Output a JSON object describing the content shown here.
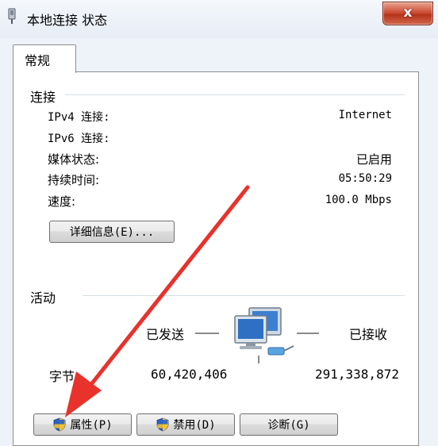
{
  "window": {
    "title": "本地连接 状态",
    "close_label": "x"
  },
  "tabs": [
    {
      "label": "常规"
    }
  ],
  "connection": {
    "section_label": "连接",
    "rows": [
      {
        "label": "IPv4 连接:",
        "value": "Internet"
      },
      {
        "label": "IPv6 连接:",
        "value": ""
      },
      {
        "label": "媒体状态:",
        "value": "已启用"
      },
      {
        "label": "持续时间:",
        "value": "05:50:29"
      },
      {
        "label": "速度:",
        "value": "100.0 Mbps"
      }
    ],
    "details_button": "详细信息(E)..."
  },
  "activity": {
    "section_label": "活动",
    "sent_label": "已发送",
    "received_label": "已接收",
    "bytes_label": "字节:",
    "bytes_sent": "60,420,406",
    "bytes_received": "291,338,872"
  },
  "buttons": {
    "properties": "属性(P)",
    "disable": "禁用(D)",
    "diagnose": "诊断(G)"
  },
  "colors": {
    "annotation_arrow": "#e8322b",
    "close_button": "#c9452d"
  }
}
